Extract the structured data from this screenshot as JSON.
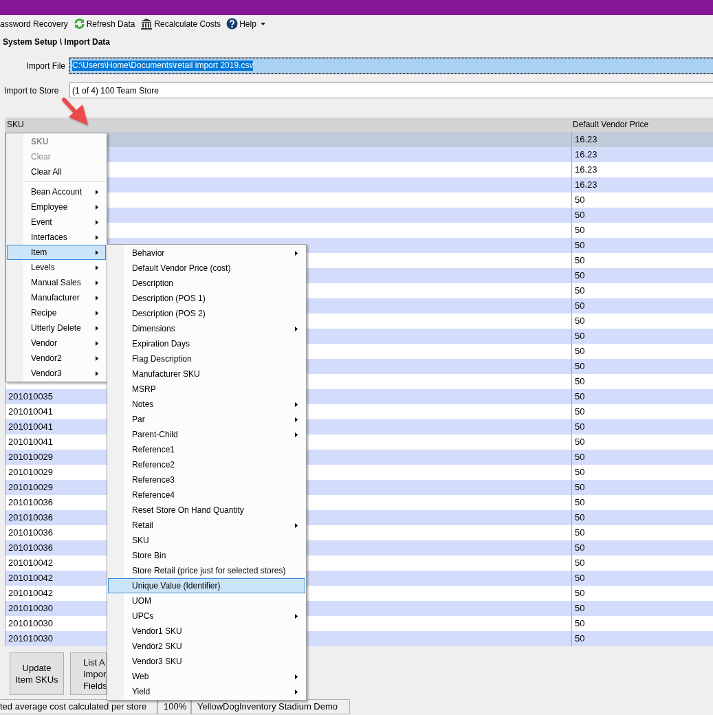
{
  "toolbar": [
    {
      "label": "assword Recovery",
      "dropdown": false
    },
    {
      "label": "Refresh Data",
      "dropdown": false
    },
    {
      "label": "Recalculate Costs",
      "dropdown": false
    },
    {
      "label": "Help",
      "dropdown": true
    }
  ],
  "breadcrumb": "System Setup \\ Import Data",
  "import_file": {
    "label": "Import File",
    "value": "C:\\Users\\Home\\Documents\\retail import 2019.csv",
    "selected": true
  },
  "import_store": {
    "label": "Import to Store",
    "value": "(1 of 4) 100 Team Store",
    "selected": false
  },
  "table": {
    "columns": [
      "SKU",
      "Default Vendor Price"
    ],
    "rows": [
      {
        "price": "16.23",
        "selected": true
      },
      {
        "price": "16.23",
        "selected": false
      },
      {
        "price": "16.23",
        "selected": false
      },
      {
        "price": "16.23",
        "selected": false
      },
      {
        "price": "50",
        "selected": false
      },
      {
        "price": "50",
        "selected": false
      },
      {
        "price": "50",
        "selected": false
      },
      {
        "price": "50",
        "selected": false
      },
      {
        "price": "50",
        "selected": false
      },
      {
        "price": "50",
        "selected": false
      },
      {
        "price": "50",
        "selected": false
      },
      {
        "price": "50",
        "selected": false
      },
      {
        "price": "50",
        "selected": false
      },
      {
        "price": "50",
        "selected": false
      },
      {
        "price": "50",
        "selected": false
      },
      {
        "price": "50",
        "selected": false
      },
      {
        "price": "50",
        "selected": false
      },
      {
        "sku": "201010035",
        "price": "50",
        "selected": false
      },
      {
        "sku": "201010041",
        "price": "50",
        "selected": false
      },
      {
        "sku": "201010041",
        "price": "50",
        "selected": false
      },
      {
        "sku": "201010041",
        "price": "50",
        "selected": false
      },
      {
        "sku": "201010029",
        "price": "50",
        "selected": false
      },
      {
        "sku": "201010029",
        "price": "50",
        "selected": false
      },
      {
        "sku": "201010029",
        "price": "50",
        "selected": false
      },
      {
        "sku": "201010036",
        "price": "50",
        "selected": false
      },
      {
        "sku": "201010036",
        "price": "50",
        "selected": false
      },
      {
        "sku": "201010036",
        "price": "50",
        "selected": false
      },
      {
        "sku": "201010036",
        "price": "50",
        "selected": false
      },
      {
        "sku": "201010042",
        "price": "50",
        "selected": false
      },
      {
        "sku": "201010042",
        "price": "50",
        "selected": false
      },
      {
        "sku": "201010042",
        "price": "50",
        "selected": false
      },
      {
        "sku": "201010030",
        "price": "50",
        "selected": false
      },
      {
        "sku": "201010030",
        "price": "50",
        "selected": false
      },
      {
        "sku": "201010030",
        "price": "50",
        "selected": false
      }
    ]
  },
  "context_menu": {
    "items": [
      {
        "kind": "header",
        "label": "SKU",
        "disabled": true,
        "selected": false,
        "submenu": false
      },
      {
        "kind": "item",
        "label": "Clear",
        "disabled": true,
        "selected": false,
        "submenu": false
      },
      {
        "kind": "item",
        "label": "Clear All",
        "disabled": false,
        "selected": false,
        "submenu": false
      },
      {
        "kind": "separator"
      },
      {
        "kind": "item",
        "label": "Bean Account",
        "disabled": false,
        "selected": false,
        "submenu": true
      },
      {
        "kind": "item",
        "label": "Employee",
        "disabled": false,
        "selected": false,
        "submenu": true
      },
      {
        "kind": "item",
        "label": "Event",
        "disabled": false,
        "selected": false,
        "submenu": true
      },
      {
        "kind": "item",
        "label": "Interfaces",
        "disabled": false,
        "selected": false,
        "submenu": true
      },
      {
        "kind": "item",
        "label": "Item",
        "disabled": false,
        "selected": true,
        "submenu": true
      },
      {
        "kind": "item",
        "label": "Levels",
        "disabled": false,
        "selected": false,
        "submenu": true
      },
      {
        "kind": "item",
        "label": "Manual Sales",
        "disabled": false,
        "selected": false,
        "submenu": true
      },
      {
        "kind": "item",
        "label": "Manufacturer",
        "disabled": false,
        "selected": false,
        "submenu": true
      },
      {
        "kind": "item",
        "label": "Recipe",
        "disabled": false,
        "selected": false,
        "submenu": true
      },
      {
        "kind": "item",
        "label": "Utterly Delete",
        "disabled": false,
        "selected": false,
        "submenu": true
      },
      {
        "kind": "item",
        "label": "Vendor",
        "disabled": false,
        "selected": false,
        "submenu": true
      },
      {
        "kind": "item",
        "label": "Vendor2",
        "disabled": false,
        "selected": false,
        "submenu": true
      },
      {
        "kind": "item",
        "label": "Vendor3",
        "disabled": false,
        "selected": false,
        "submenu": true
      }
    ]
  },
  "submenu": {
    "items": [
      {
        "kind": "item",
        "label": "Behavior",
        "selected": false,
        "submenu": true
      },
      {
        "kind": "item",
        "label": "Default Vendor Price (cost)",
        "selected": false,
        "submenu": false
      },
      {
        "kind": "item",
        "label": "Description",
        "selected": false,
        "submenu": false
      },
      {
        "kind": "item",
        "label": "Description (POS 1)",
        "selected": false,
        "submenu": false
      },
      {
        "kind": "item",
        "label": "Description (POS 2)",
        "selected": false,
        "submenu": false
      },
      {
        "kind": "item",
        "label": "Dimensions",
        "selected": false,
        "submenu": true
      },
      {
        "kind": "item",
        "label": "Expiration Days",
        "selected": false,
        "submenu": false
      },
      {
        "kind": "item",
        "label": "Flag Description",
        "selected": false,
        "submenu": false
      },
      {
        "kind": "item",
        "label": "Manufacturer SKU",
        "selected": false,
        "submenu": false
      },
      {
        "kind": "item",
        "label": "MSRP",
        "selected": false,
        "submenu": false
      },
      {
        "kind": "item",
        "label": "Notes",
        "selected": false,
        "submenu": true
      },
      {
        "kind": "item",
        "label": "Par",
        "selected": false,
        "submenu": true
      },
      {
        "kind": "item",
        "label": "Parent-Child",
        "selected": false,
        "submenu": true
      },
      {
        "kind": "item",
        "label": "Reference1",
        "selected": false,
        "submenu": false
      },
      {
        "kind": "item",
        "label": "Reference2",
        "selected": false,
        "submenu": false
      },
      {
        "kind": "item",
        "label": "Reference3",
        "selected": false,
        "submenu": false
      },
      {
        "kind": "item",
        "label": "Reference4",
        "selected": false,
        "submenu": false
      },
      {
        "kind": "item",
        "label": "Reset Store On Hand Quantity",
        "selected": false,
        "submenu": false
      },
      {
        "kind": "item",
        "label": "Retail",
        "selected": false,
        "submenu": true
      },
      {
        "kind": "item",
        "label": "SKU",
        "selected": false,
        "submenu": false
      },
      {
        "kind": "item",
        "label": "Store Bin",
        "selected": false,
        "submenu": false
      },
      {
        "kind": "item",
        "label": "Store Retail (price just for selected stores)",
        "selected": false,
        "submenu": false
      },
      {
        "kind": "item",
        "label": "Unique Value (Identifier)",
        "selected": true,
        "submenu": false
      },
      {
        "kind": "item",
        "label": "UOM",
        "selected": false,
        "submenu": false
      },
      {
        "kind": "item",
        "label": "UPCs",
        "selected": false,
        "submenu": true
      },
      {
        "kind": "item",
        "label": "Vendor1 SKU",
        "selected": false,
        "submenu": false
      },
      {
        "kind": "item",
        "label": "Vendor2 SKU",
        "selected": false,
        "submenu": false
      },
      {
        "kind": "item",
        "label": "Vendor3 SKU",
        "selected": false,
        "submenu": false
      },
      {
        "kind": "item",
        "label": "Web",
        "selected": false,
        "submenu": true
      },
      {
        "kind": "item",
        "label": "Yield",
        "selected": false,
        "submenu": true
      }
    ]
  },
  "buttons": [
    {
      "label": "Update\nItem SKUs"
    },
    {
      "label": "List A\nImpor\nFields"
    }
  ],
  "status_bar": [
    "ted average cost calculated per store",
    "100%",
    "YellowDogInventory Stadium Demo"
  ]
}
